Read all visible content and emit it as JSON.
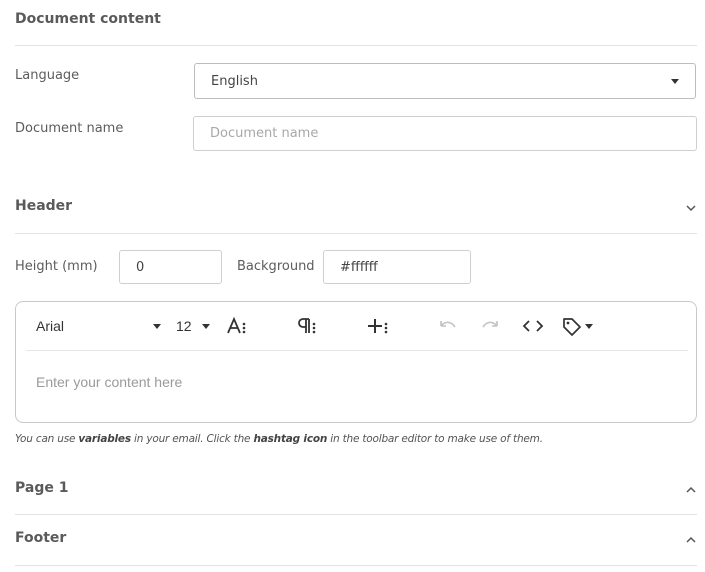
{
  "document_content": {
    "title": "Document content",
    "language_label": "Language",
    "language_value": "English",
    "document_name_label": "Document name",
    "document_name_placeholder": "Document name"
  },
  "header": {
    "title": "Header",
    "height_label": "Height (mm)",
    "height_value": "0",
    "background_label": "Background",
    "background_value": "#ffffff"
  },
  "editor": {
    "font_family": "Arial",
    "font_size": "12",
    "placeholder": "Enter your content here"
  },
  "hint": {
    "part1": "You can use ",
    "variables": "variables",
    "part2": " in your email. Click the ",
    "hashtag_icon": "hashtag icon",
    "part3": " in the toolbar editor to make use of them."
  },
  "sections": {
    "page1": "Page 1",
    "footer": "Footer"
  },
  "colors": {
    "border": "#cfcfcf",
    "divider": "#e3e3e3",
    "text": "#5a5a5a",
    "placeholder": "#a8a8a8"
  },
  "icons": {
    "chevron_down": "chevron-down-icon",
    "chevron_up": "chevron-up-icon",
    "font_size": "font-size-icon",
    "paragraph": "paragraph-icon",
    "insert": "insert-plus-icon",
    "undo": "undo-icon",
    "redo": "redo-icon",
    "code": "code-view-icon",
    "tag": "tag-variables-icon"
  }
}
